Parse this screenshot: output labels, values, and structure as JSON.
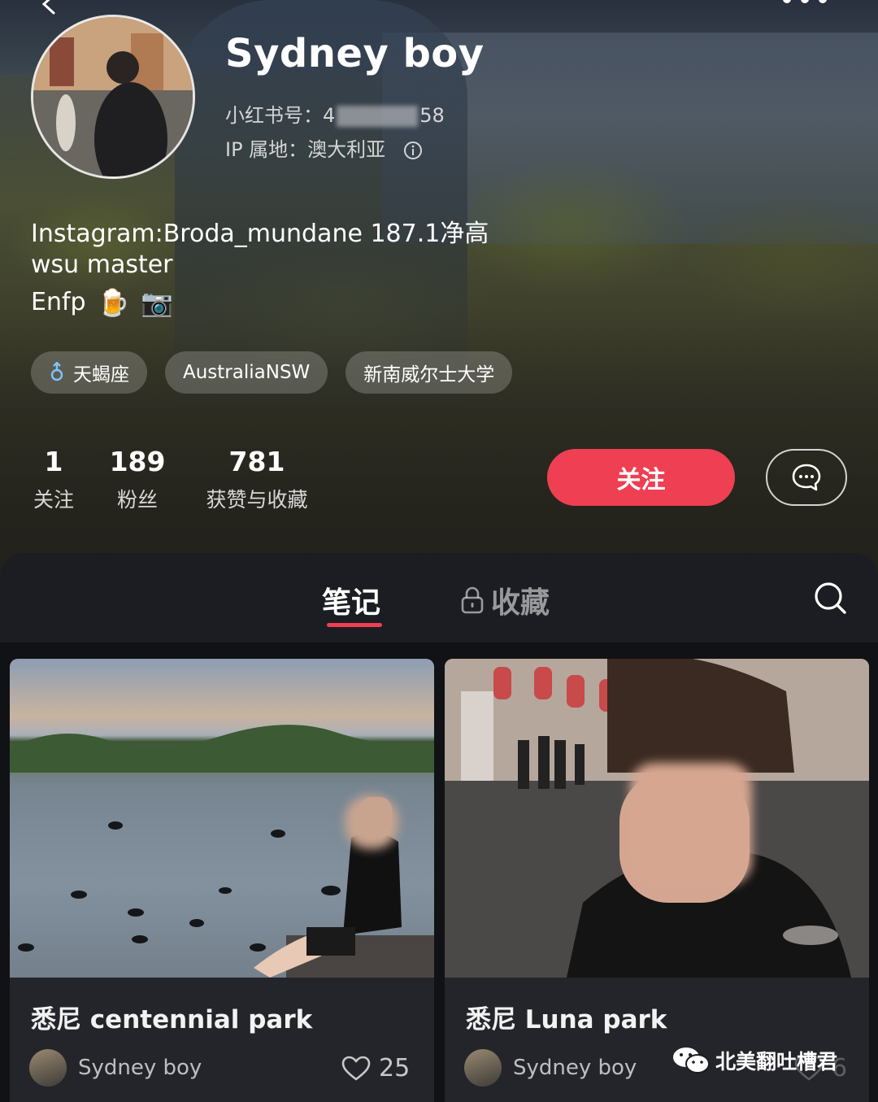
{
  "profile": {
    "name": "Sydney boy",
    "id_prefix": "小红书号：4",
    "id_suffix": "58",
    "ip_location": "IP 属地：澳大利亚",
    "bio_lines": [
      "Instagram:Broda_mundane   187.1净高",
      "wsu master",
      "Enfp"
    ],
    "bio_emojis": [
      "🍺",
      "📷"
    ],
    "tags": [
      "天蝎座",
      "AustraliaNSW",
      "新南威尔士大学"
    ]
  },
  "stats": [
    {
      "value": "1",
      "label": "关注"
    },
    {
      "value": "189",
      "label": "粉丝"
    },
    {
      "value": "781",
      "label": "获赞与收藏"
    }
  ],
  "actions": {
    "follow_label": "关注"
  },
  "tabs": {
    "notes": "笔记",
    "favorites": "收藏"
  },
  "notes": [
    {
      "title": "悉尼 centennial park",
      "author": "Sydney boy",
      "likes": "25"
    },
    {
      "title": "悉尼 Luna park",
      "author": "Sydney boy",
      "likes": "6"
    }
  ],
  "watermark": "北美翻吐槽君",
  "colors": {
    "accent": "#ef3f52",
    "panel": "#1c1d22"
  },
  "icons": [
    "back-icon",
    "more-icon",
    "info-icon",
    "zodiac-icon",
    "message-icon",
    "lock-icon",
    "search-icon",
    "heart-icon",
    "wechat-icon"
  ]
}
